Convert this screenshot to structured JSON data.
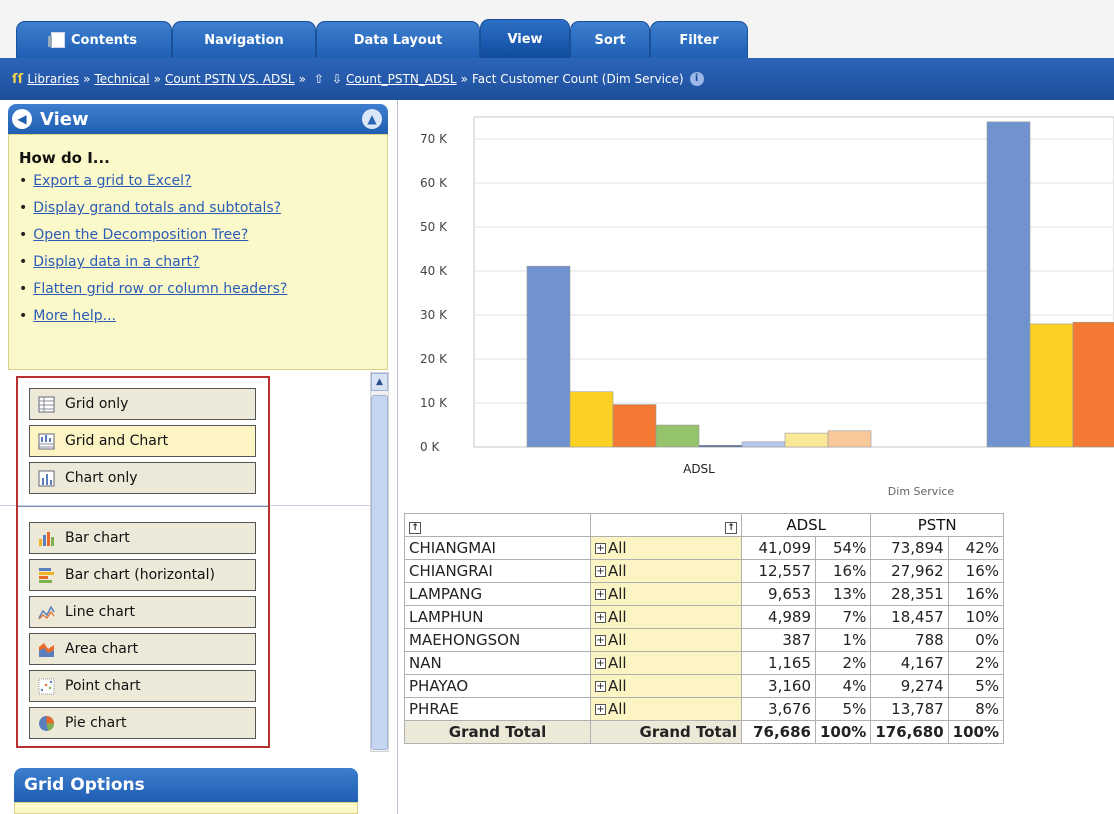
{
  "tabs": [
    {
      "label": "Contents"
    },
    {
      "label": "Navigation"
    },
    {
      "label": "Data Layout"
    },
    {
      "label": "View"
    },
    {
      "label": "Sort"
    },
    {
      "label": "Filter"
    }
  ],
  "breadcrumb": {
    "items": [
      "Libraries",
      "Technical",
      "Count PSTN VS. ADSL",
      "Count_PSTN_ADSL"
    ],
    "current": "Fact Customer Count (Dim Service)"
  },
  "view_panel": {
    "title": "View",
    "howdo_title": "How do I...",
    "help_links": [
      "Export a grid to Excel?",
      "Display grand totals and subtotals?",
      "Open the Decomposition Tree?",
      "Display data in a chart?",
      "Flatten grid row or column headers?",
      "More help..."
    ],
    "layout_options": [
      "Grid only",
      "Grid and Chart",
      "Chart only"
    ],
    "chart_options": [
      "Bar chart",
      "Bar chart (horizontal)",
      "Line chart",
      "Area chart",
      "Point chart",
      "Pie chart"
    ],
    "grid_options_title": "Grid Options"
  },
  "chart_data": {
    "type": "bar",
    "categories": [
      "ADSL",
      "PSTN"
    ],
    "series": [
      {
        "name": "CHIANGMAI",
        "color": "#7093cf",
        "values": [
          41099,
          73894
        ]
      },
      {
        "name": "CHIANGRAI",
        "color": "#fcd123",
        "values": [
          12557,
          27962
        ]
      },
      {
        "name": "LAMPANG",
        "color": "#f47932",
        "values": [
          9653,
          28351
        ]
      },
      {
        "name": "LAMPHUN",
        "color": "#94c36c",
        "values": [
          4989,
          18457
        ]
      },
      {
        "name": "MAEHONGSON",
        "color": "#4a6fa8",
        "values": [
          387,
          788
        ]
      },
      {
        "name": "NAN",
        "color": "#b4c9ec",
        "values": [
          1165,
          4167
        ]
      },
      {
        "name": "PHAYAO",
        "color": "#fbe896",
        "values": [
          3160,
          9274
        ]
      },
      {
        "name": "PHRAE",
        "color": "#f8c89b",
        "values": [
          3676,
          13787
        ]
      }
    ],
    "y_ticks": [
      "0 K",
      "10 K",
      "20 K",
      "30 K",
      "40 K",
      "50 K",
      "60 K",
      "70 K"
    ],
    "ylim": [
      0,
      75000
    ],
    "xlabel": "Dim Service",
    "grid": true
  },
  "grid": {
    "col_headers": [
      "ADSL",
      "PSTN"
    ],
    "all_label": "All",
    "rows": [
      {
        "name": "CHIANGMAI",
        "adsl": "41,099",
        "adsl_pct": "54%",
        "pstn": "73,894",
        "pstn_pct": "42%"
      },
      {
        "name": "CHIANGRAI",
        "adsl": "12,557",
        "adsl_pct": "16%",
        "pstn": "27,962",
        "pstn_pct": "16%"
      },
      {
        "name": "LAMPANG",
        "adsl": "9,653",
        "adsl_pct": "13%",
        "pstn": "28,351",
        "pstn_pct": "16%"
      },
      {
        "name": "LAMPHUN",
        "adsl": "4,989",
        "adsl_pct": "7%",
        "pstn": "18,457",
        "pstn_pct": "10%"
      },
      {
        "name": "MAEHONGSON",
        "adsl": "387",
        "adsl_pct": "1%",
        "pstn": "788",
        "pstn_pct": "0%"
      },
      {
        "name": "NAN",
        "adsl": "1,165",
        "adsl_pct": "2%",
        "pstn": "4,167",
        "pstn_pct": "2%"
      },
      {
        "name": "PHAYAO",
        "adsl": "3,160",
        "adsl_pct": "4%",
        "pstn": "9,274",
        "pstn_pct": "5%"
      },
      {
        "name": "PHRAE",
        "adsl": "3,676",
        "adsl_pct": "5%",
        "pstn": "13,787",
        "pstn_pct": "8%"
      }
    ],
    "total": {
      "label": "Grand Total",
      "label2": "Grand Total",
      "adsl": "76,686",
      "adsl_pct": "100%",
      "pstn": "176,680",
      "pstn_pct": "100%"
    }
  }
}
